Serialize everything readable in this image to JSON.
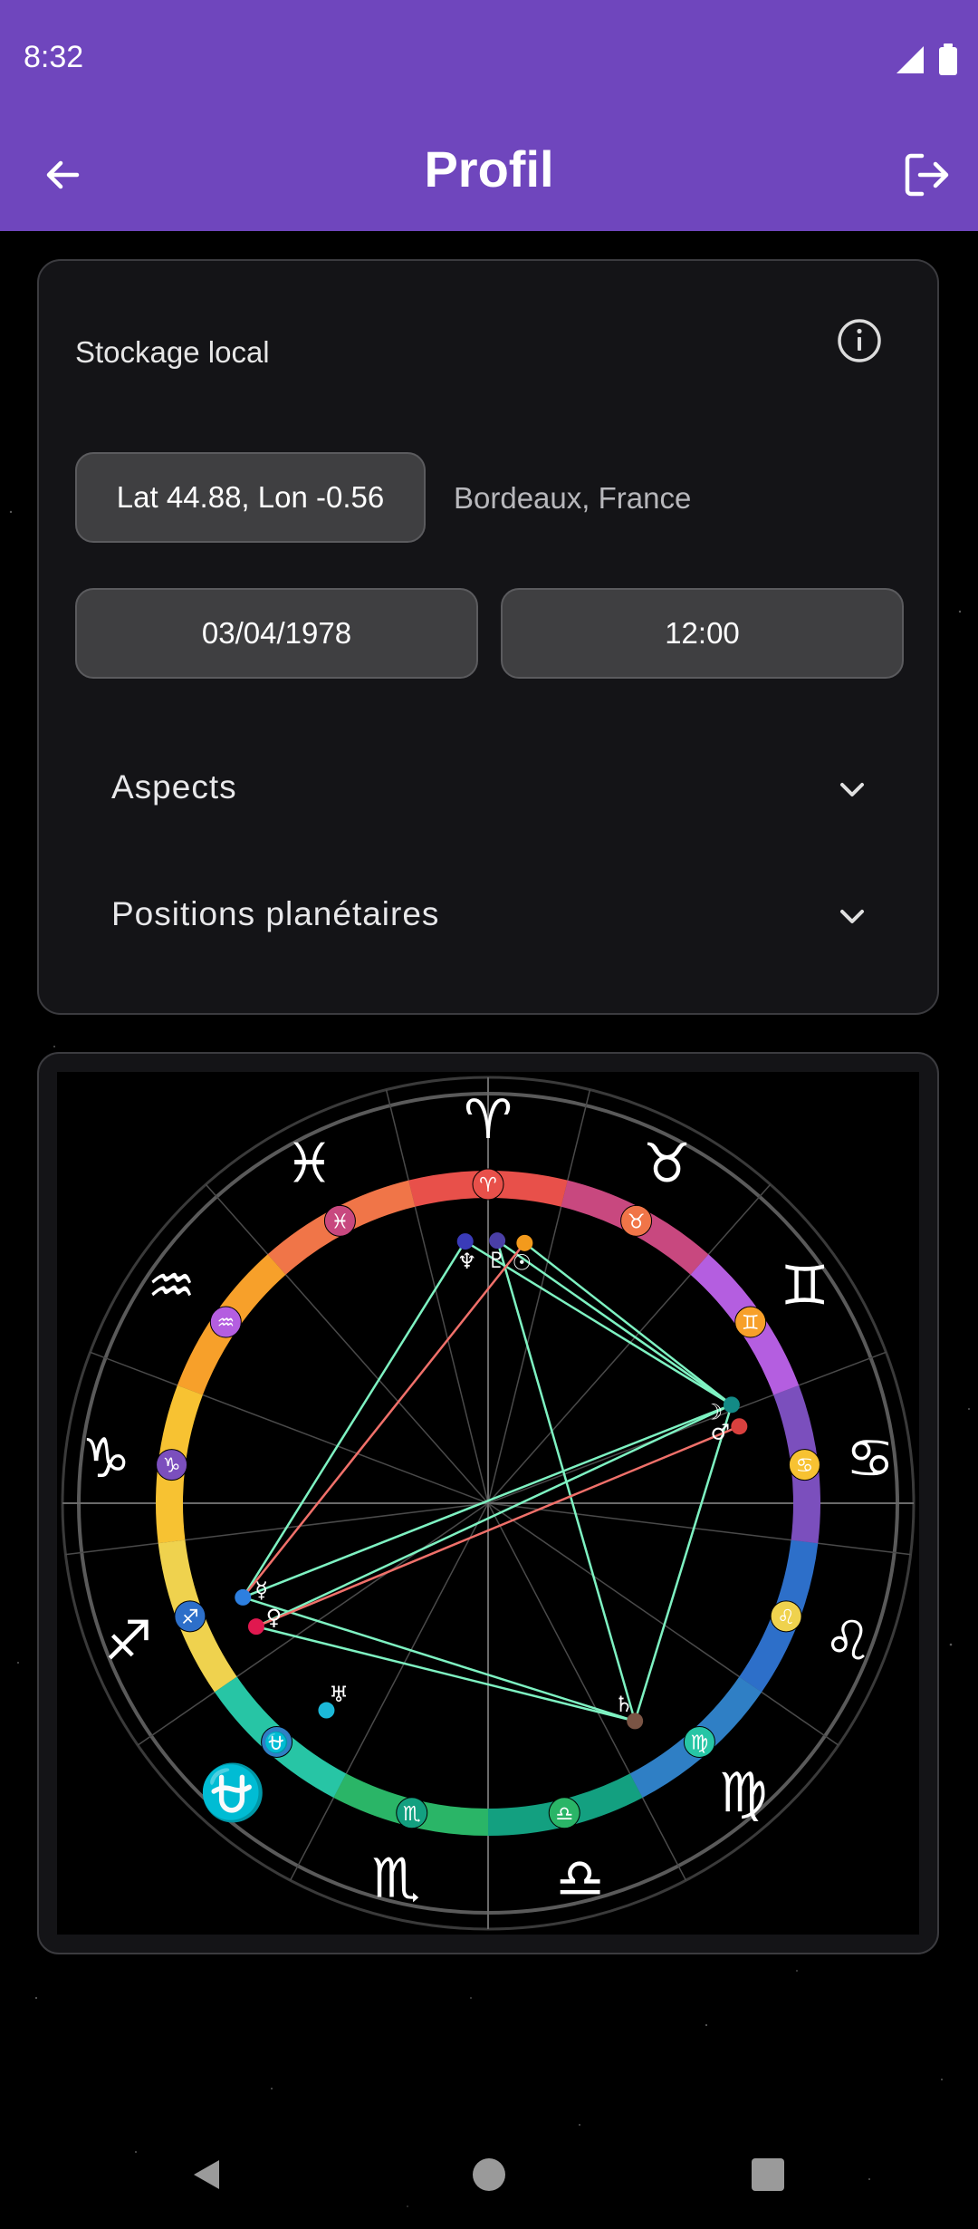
{
  "status_bar": {
    "time": "8:32",
    "signal_icon": "signal-icon",
    "battery_icon": "battery-icon"
  },
  "app_bar": {
    "title": "Profil",
    "back_icon": "arrow-back-icon",
    "logout_icon": "logout-icon"
  },
  "colors": {
    "accent": "#6f46bd",
    "card": "#141417",
    "pill": "#3f3f41",
    "aspect_trine": "#7ef2c2",
    "aspect_square": "#f0706a"
  },
  "profile": {
    "storage_label": "Stockage local",
    "info_icon": "info-icon",
    "coordinates": "Lat 44.88, Lon -0.56",
    "location": "Bordeaux, France",
    "date": "03/04/1978",
    "time": "12:00",
    "sections": [
      {
        "label": "Aspects",
        "icon": "chevron-down-icon"
      },
      {
        "label": "Positions planétaires",
        "icon": "chevron-down-icon"
      }
    ]
  },
  "chart_data": {
    "type": "astrological-wheel",
    "signs": [
      {
        "name": "aries",
        "glyph": "♈",
        "color": "#e8504a"
      },
      {
        "name": "taurus",
        "glyph": "♉",
        "color": "#f07548"
      },
      {
        "name": "gemini",
        "glyph": "♊",
        "color": "#f7a02a"
      },
      {
        "name": "cancer",
        "glyph": "♋",
        "color": "#f7c232"
      },
      {
        "name": "leo",
        "glyph": "♌",
        "color": "#efd24e"
      },
      {
        "name": "virgo",
        "glyph": "♍",
        "color": "#27c5a5"
      },
      {
        "name": "libra",
        "glyph": "♎",
        "color": "#2ab567"
      },
      {
        "name": "scorpio",
        "glyph": "♏",
        "color": "#13a080"
      },
      {
        "name": "ophiuchus",
        "glyph": "⛎",
        "color": "#2f7fc5"
      },
      {
        "name": "sagittarius",
        "glyph": "♐",
        "color": "#2d6fc9"
      },
      {
        "name": "capricorn",
        "glyph": "♑",
        "color": "#7b4fbd"
      },
      {
        "name": "aquarius",
        "glyph": "♒",
        "color": "#b45ee0"
      },
      {
        "name": "pisces",
        "glyph": "♓",
        "color": "#c8487f"
      }
    ],
    "planets": [
      {
        "name": "neptune",
        "glyph": "♆",
        "color": "#3a3bb8",
        "angle": 95
      },
      {
        "name": "pluto",
        "glyph": "♇",
        "color": "#4a3fa6",
        "angle": 88
      },
      {
        "name": "sun",
        "glyph": "☉",
        "color": "#f39a1c",
        "angle": 82
      },
      {
        "name": "moon",
        "glyph": "☽",
        "color": "#138a86",
        "angle": 22
      },
      {
        "name": "mars",
        "glyph": "♂",
        "color": "#d9403e",
        "angle": 17
      },
      {
        "name": "saturn",
        "glyph": "♄",
        "color": "#7a5444",
        "angle": -56
      },
      {
        "name": "uranus",
        "glyph": "♅",
        "color": "#1bb8d8",
        "angle": -128
      },
      {
        "name": "venus",
        "glyph": "♀",
        "color": "#e0184f",
        "angle": -152
      },
      {
        "name": "mercury",
        "glyph": "☿",
        "color": "#2d7fe0",
        "angle": -159
      }
    ],
    "aspects": [
      {
        "from": "neptune",
        "to": "mercury",
        "kind": "trine"
      },
      {
        "from": "neptune",
        "to": "moon",
        "kind": "trine"
      },
      {
        "from": "pluto",
        "to": "moon",
        "kind": "trine"
      },
      {
        "from": "pluto",
        "to": "saturn",
        "kind": "trine"
      },
      {
        "from": "sun",
        "to": "mercury",
        "kind": "square"
      },
      {
        "from": "sun",
        "to": "moon",
        "kind": "trine"
      },
      {
        "from": "moon",
        "to": "venus",
        "kind": "trine"
      },
      {
        "from": "moon",
        "to": "saturn",
        "kind": "trine"
      },
      {
        "from": "mercury",
        "to": "saturn",
        "kind": "trine"
      },
      {
        "from": "mercury",
        "to": "moon",
        "kind": "trine"
      },
      {
        "from": "mars",
        "to": "venus",
        "kind": "square"
      },
      {
        "from": "venus",
        "to": "saturn",
        "kind": "trine"
      }
    ]
  },
  "nav_bar": {
    "back_icon": "nav-back-icon",
    "home_icon": "nav-home-icon",
    "recents_icon": "nav-recents-icon"
  }
}
